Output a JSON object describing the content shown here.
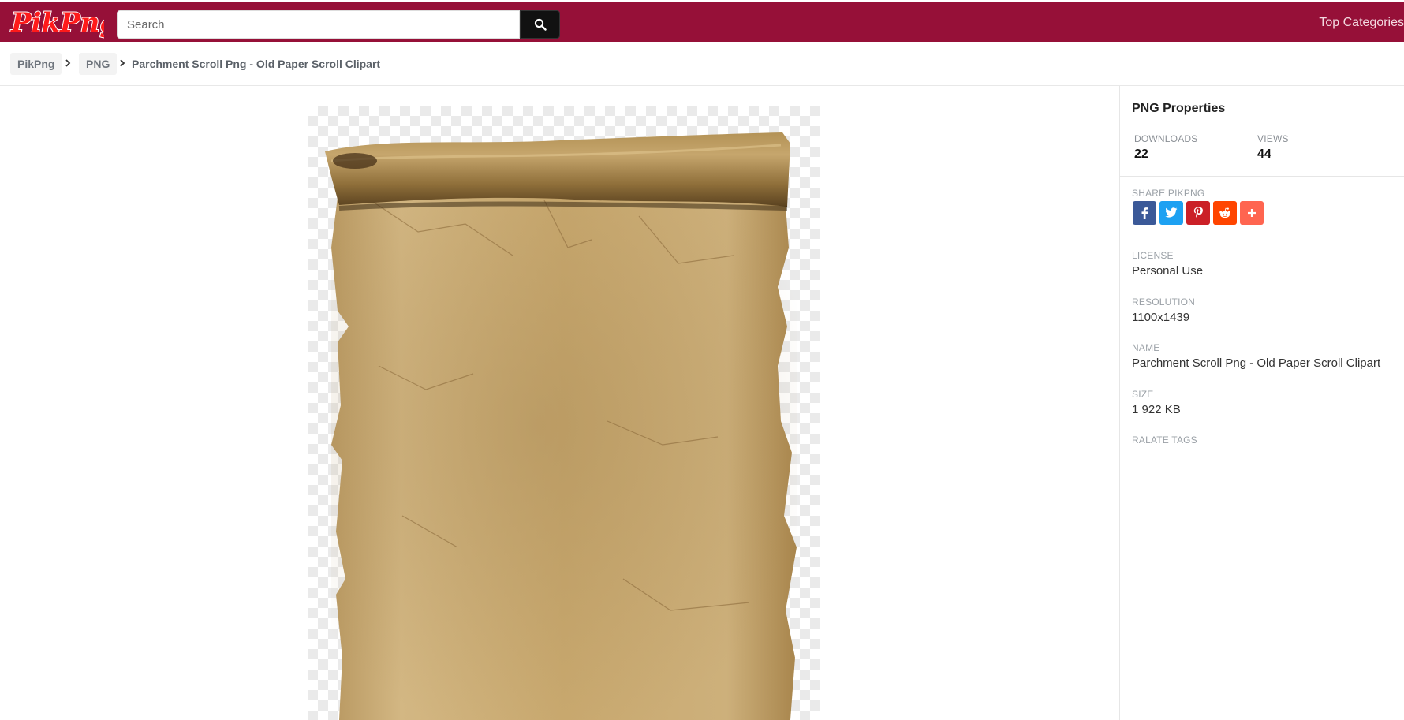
{
  "header": {
    "logo_text": "PikPng",
    "search_placeholder": "Search",
    "top_categories": "Top Categories",
    "colors": {
      "brand_bar": "#961038",
      "logo": "#ff1a1a"
    }
  },
  "breadcrumb": {
    "items": [
      {
        "label": "PikPng"
      },
      {
        "label": "PNG"
      },
      {
        "label": "Parchment Scroll Png - Old Paper Scroll Clipart"
      }
    ]
  },
  "sidebar": {
    "title": "PNG Properties",
    "downloads_label": "DOWNLOADS",
    "downloads_value": "22",
    "views_label": "VIEWS",
    "views_value": "44",
    "share_label": "SHARE PIKPNG",
    "share_buttons": [
      {
        "icon": "facebook-icon",
        "color": "#3b5998"
      },
      {
        "icon": "twitter-icon",
        "color": "#1da1f2"
      },
      {
        "icon": "pinterest-icon",
        "color": "#cb2027"
      },
      {
        "icon": "reddit-icon",
        "color": "#ff4500"
      },
      {
        "icon": "plus-icon",
        "color": "#ff6550"
      }
    ],
    "license_label": "LICENSE",
    "license_value": "Personal Use",
    "resolution_label": "RESOLUTION",
    "resolution_value": "1100x1439",
    "name_label": "NAME",
    "name_value": "Parchment Scroll Png - Old Paper Scroll Clipart",
    "size_label": "SIZE",
    "size_value": "1 922 KB",
    "tags_label": "RALATE TAGS"
  }
}
